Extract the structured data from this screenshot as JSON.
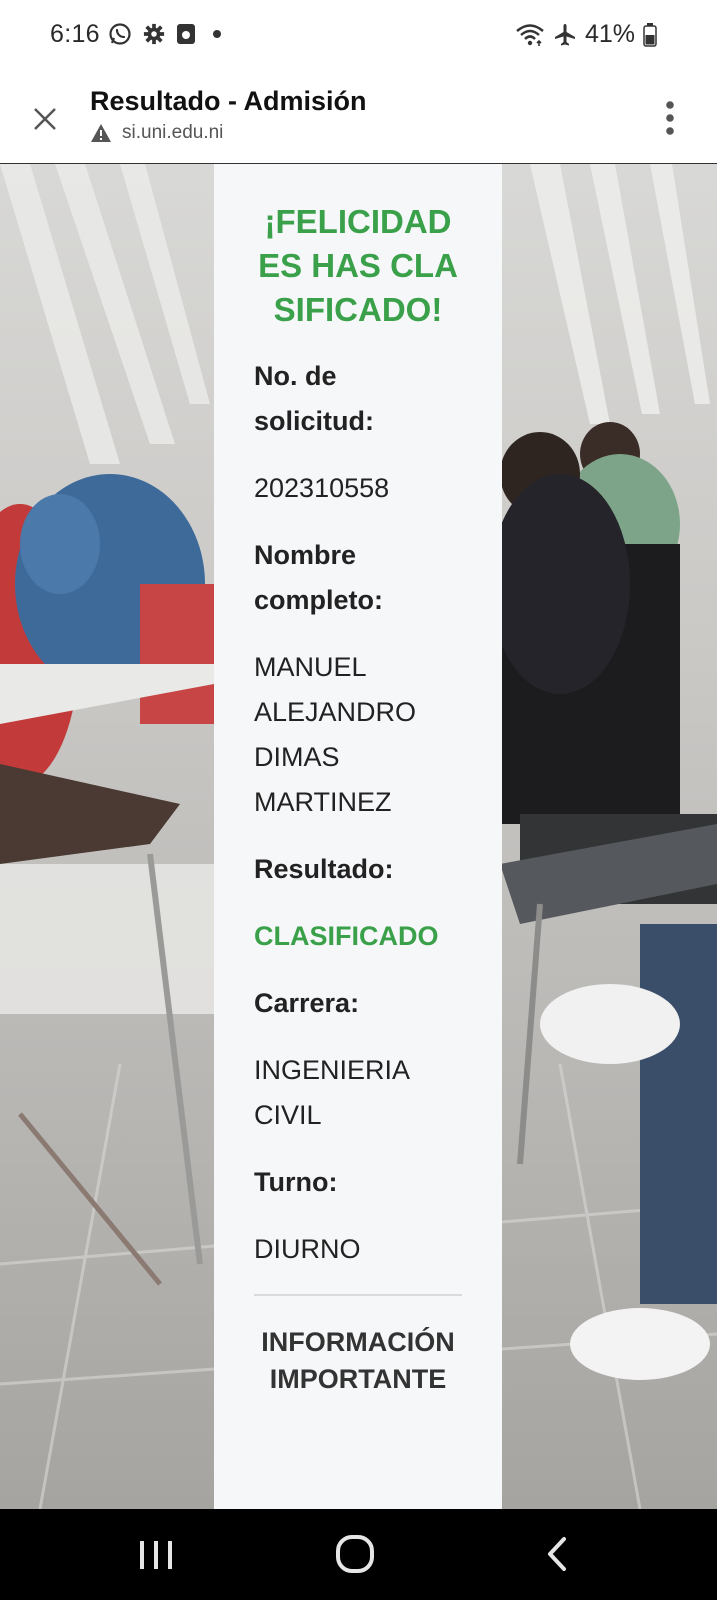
{
  "status_bar": {
    "time": "6:16",
    "battery": "41%",
    "icons_left": [
      "whatsapp-icon",
      "gear-icon",
      "media-icon",
      "notification-dot"
    ],
    "icons_right": [
      "wifi-icon",
      "airplane-icon",
      "battery-icon"
    ]
  },
  "browser": {
    "title": "Resultado - Admisión",
    "url": "si.uni.edu.ni",
    "security_icon": "warning-icon"
  },
  "result": {
    "headline": "¡FELICIDADES HAS CLASIFICADO!",
    "fields": [
      {
        "label": "No. de solicitud:",
        "value": "202310558"
      },
      {
        "label": "Nombre completo:",
        "value": "MANUEL ALEJANDRO DIMAS MARTINEZ"
      },
      {
        "label": "Resultado:",
        "value": "CLASIFICADO"
      },
      {
        "label": "Carrera:",
        "value": "INGENIERIA CIVIL"
      },
      {
        "label": "Turno:",
        "value": "DIURNO"
      }
    ],
    "info_title": "INFORMACIÓN IMPORTANTE"
  },
  "colors": {
    "accent_green": "#3aa14a",
    "card_bg": "#f6f7f9",
    "text": "#222222"
  }
}
